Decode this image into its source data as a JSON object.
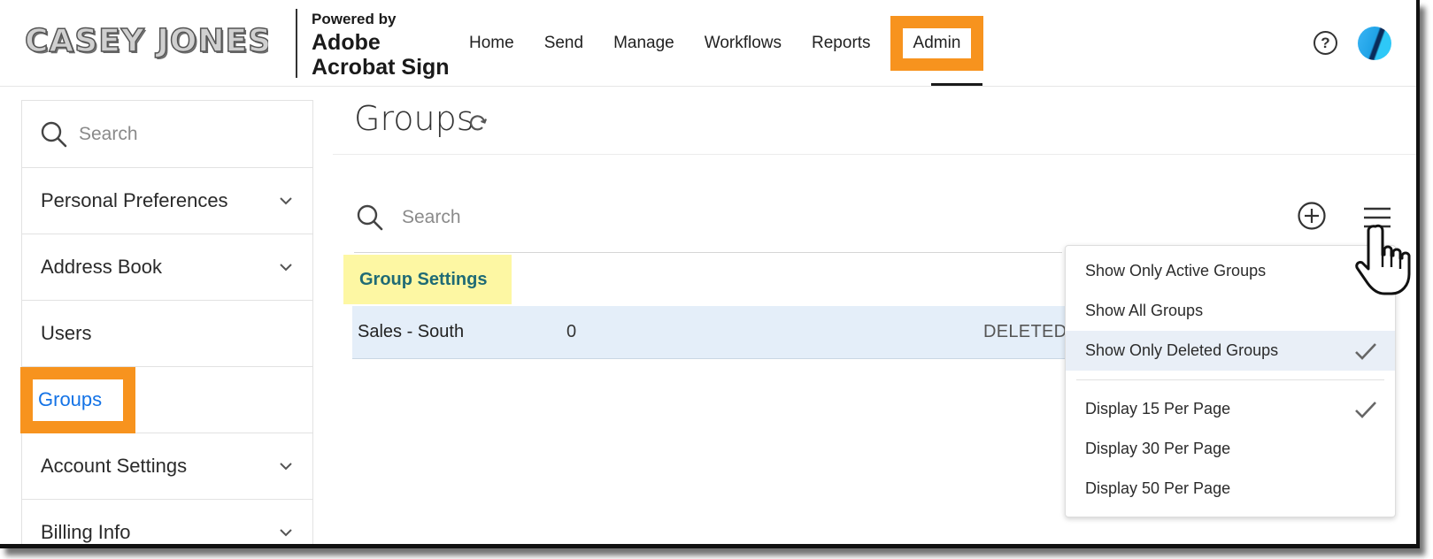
{
  "header": {
    "logo_text": "CASEY JONES",
    "powered_by": "Powered by",
    "product_line1": "Adobe",
    "product_line2": "Acrobat Sign",
    "nav": [
      {
        "label": "Home"
      },
      {
        "label": "Send"
      },
      {
        "label": "Manage"
      },
      {
        "label": "Workflows"
      },
      {
        "label": "Reports"
      },
      {
        "label": "Admin",
        "active": true
      }
    ],
    "help_icon": "help-circle-icon",
    "help_glyph": "?",
    "avatar_icon": "user-avatar"
  },
  "sidebar": {
    "search_placeholder": "Search",
    "items": [
      {
        "label": "Personal Preferences",
        "expandable": true
      },
      {
        "label": "Address Book",
        "expandable": true
      },
      {
        "label": "Users",
        "expandable": false
      },
      {
        "label": "Groups",
        "expandable": false,
        "active": true
      },
      {
        "label": "Account Settings",
        "expandable": true
      },
      {
        "label": "Billing Info",
        "expandable": true
      }
    ]
  },
  "main": {
    "title": "Groups",
    "search_placeholder": "Search",
    "group_settings_label": "Group Settings",
    "rows": [
      {
        "name": "Sales - South",
        "count": "0",
        "status": "DELETED"
      }
    ]
  },
  "dropdown": {
    "items": [
      {
        "label": "Show Only Active Groups",
        "checked": false
      },
      {
        "label": "Show All Groups",
        "checked": false
      },
      {
        "label": "Show Only Deleted Groups",
        "checked": true,
        "selected": true
      },
      {
        "label": "Display 15 Per Page",
        "checked": true
      },
      {
        "label": "Display 30 Per Page",
        "checked": false
      },
      {
        "label": "Display 50 Per Page",
        "checked": false
      }
    ]
  },
  "colors": {
    "highlight_orange": "#f7931e",
    "active_blue": "#1473e6",
    "settings_yellow": "#fdf7a3",
    "row_blue": "#e4eef9",
    "settings_text": "#1f6b75"
  }
}
